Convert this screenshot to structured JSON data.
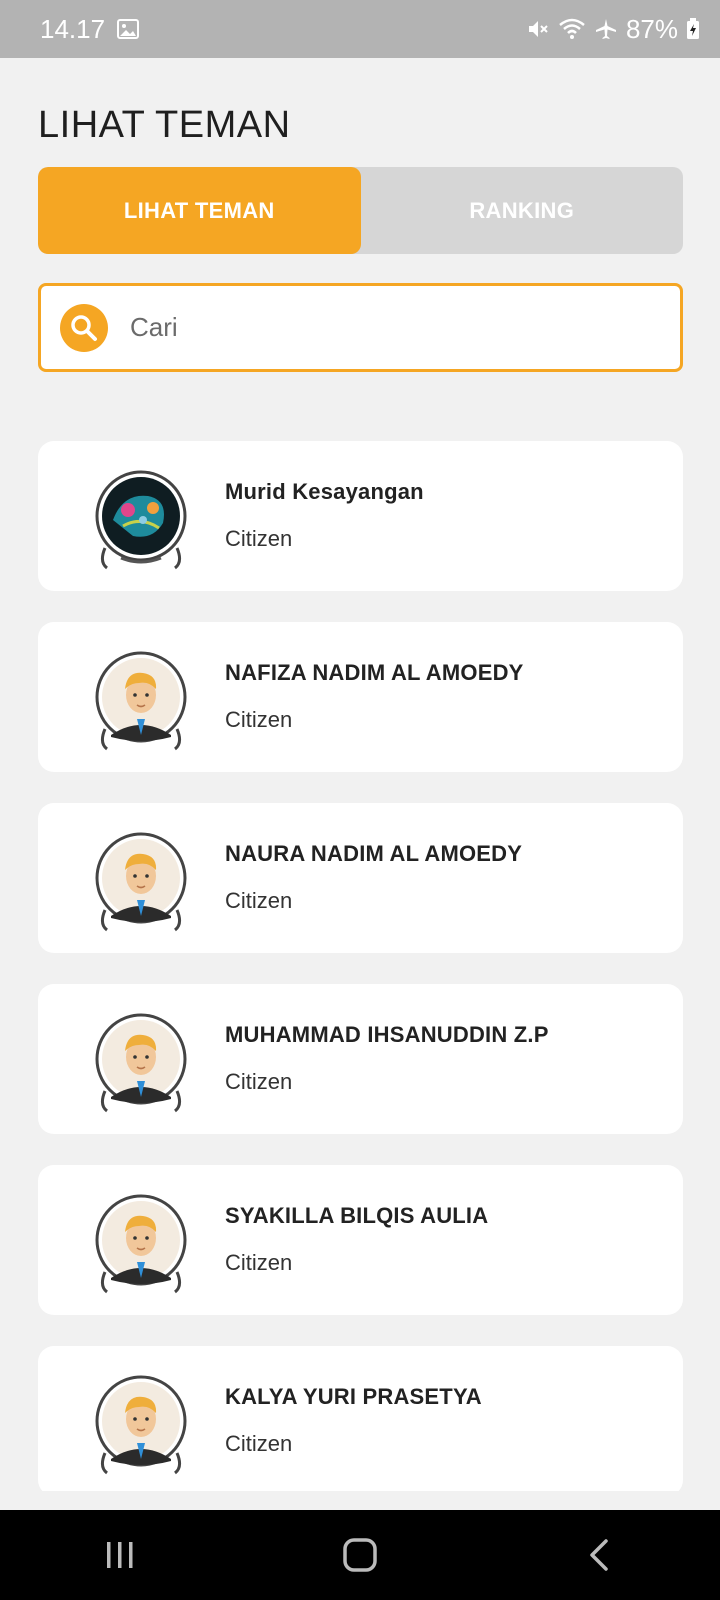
{
  "status_bar": {
    "time": "14.17",
    "battery": "87%",
    "icons": [
      "image-icon",
      "mute-icon",
      "wifi-icon",
      "airplane-icon",
      "battery-icon"
    ]
  },
  "header": {
    "title": "LIHAT TEMAN"
  },
  "tabs": [
    {
      "label": "LIHAT TEMAN",
      "active": true
    },
    {
      "label": "RANKING",
      "active": false
    }
  ],
  "search": {
    "placeholder": "Cari",
    "value": ""
  },
  "friends": [
    {
      "name": "Murid Kesayangan",
      "role": "Citizen",
      "avatar": "custom-avatar"
    },
    {
      "name": "NAFIZA NADIM AL AMOEDY",
      "role": "Citizen",
      "avatar": "default-avatar"
    },
    {
      "name": "NAURA NADIM AL AMOEDY",
      "role": "Citizen",
      "avatar": "default-avatar"
    },
    {
      "name": "MUHAMMAD IHSANUDDIN Z.P",
      "role": "Citizen",
      "avatar": "default-avatar"
    },
    {
      "name": "SYAKILLA BILQIS AULIA",
      "role": "Citizen",
      "avatar": "default-avatar"
    },
    {
      "name": "KALYA YURI PRASETYA",
      "role": "Citizen",
      "avatar": "default-avatar"
    }
  ],
  "nav_bar": {
    "buttons": [
      "recents-icon",
      "home-icon",
      "back-icon"
    ]
  },
  "colors": {
    "accent": "#f5a623",
    "status_bar": "#b3b3b3",
    "background": "#f1f1f1"
  }
}
